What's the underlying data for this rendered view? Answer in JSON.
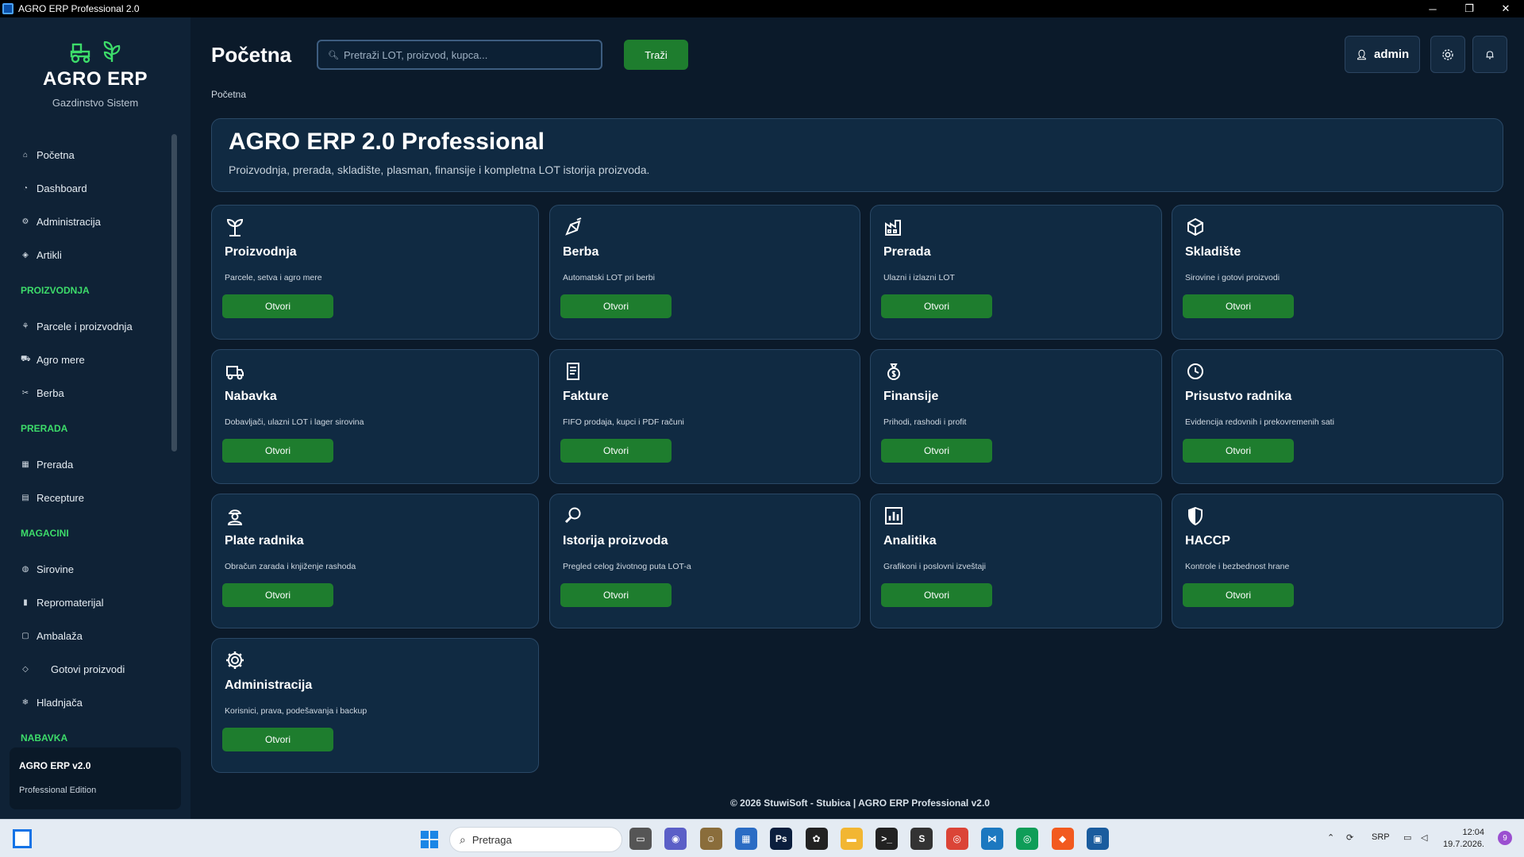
{
  "window": {
    "title": "AGRO ERP Professional 2.0",
    "minimize": "─",
    "maximize": "❐",
    "close": "✕"
  },
  "sidebar": {
    "brand": "AGRO ERP",
    "subtitle": "Gazdinstvo Sistem",
    "items": [
      {
        "type": "item",
        "label": "Početna",
        "icon": "home-icon"
      },
      {
        "type": "item",
        "label": "Dashboard",
        "icon": "dashboard-icon"
      },
      {
        "type": "item",
        "label": "Administracija",
        "icon": "gear-icon"
      },
      {
        "type": "item",
        "label": "Artikli",
        "icon": "tag-icon"
      },
      {
        "type": "section",
        "label": "PROIZVODNJA"
      },
      {
        "type": "item",
        "label": "Parcele i proizvodnja",
        "icon": "sprout-icon"
      },
      {
        "type": "item",
        "label": "Agro mere",
        "icon": "tractor-icon"
      },
      {
        "type": "item",
        "label": "Berba",
        "icon": "harvest-icon"
      },
      {
        "type": "section",
        "label": "PRERADA"
      },
      {
        "type": "item",
        "label": "Prerada",
        "icon": "factory-icon"
      },
      {
        "type": "item",
        "label": "Recepture",
        "icon": "recipe-icon"
      },
      {
        "type": "section",
        "label": "MAGACINI"
      },
      {
        "type": "item",
        "label": "Sirovine",
        "icon": "raw-materials-icon"
      },
      {
        "type": "item",
        "label": "Repromaterijal",
        "icon": "bottle-icon"
      },
      {
        "type": "item",
        "label": "Ambalaža",
        "icon": "box-icon"
      },
      {
        "type": "item",
        "label": "Gotovi proizvodi",
        "icon": "product-icon"
      },
      {
        "type": "item",
        "label": "Hladnjača",
        "icon": "snowflake-icon"
      },
      {
        "type": "section",
        "label": "NABAVKA"
      }
    ],
    "version_title": "AGRO ERP v2.0",
    "version_sub": "Professional Edition"
  },
  "header": {
    "title": "Početna",
    "search_placeholder": "Pretraži LOT, proizvod, kupca...",
    "search_button": "Traži",
    "user": "admin",
    "settings_icon": "gear-icon",
    "notifications_icon": "bell-icon"
  },
  "breadcrumb": "Početna",
  "hero": {
    "title": "AGRO ERP 2.0 Professional",
    "subtitle": "Proizvodnja, prerada, skladište, plasman, finansije i kompletna LOT istorija proizvoda."
  },
  "modules": [
    {
      "title": "Proizvodnja",
      "desc": "Parcele, setva i agro mere",
      "button": "Otvori",
      "icon": "sprout-icon"
    },
    {
      "title": "Berba",
      "desc": "Automatski LOT pri berbi",
      "button": "Otvori",
      "icon": "harvest-icon"
    },
    {
      "title": "Prerada",
      "desc": "Ulazni i izlazni LOT",
      "button": "Otvori",
      "icon": "factory-icon"
    },
    {
      "title": "Skladište",
      "desc": "Sirovine i gotovi proizvodi",
      "button": "Otvori",
      "icon": "package-icon"
    },
    {
      "title": "Nabavka",
      "desc": "Dobavljači, ulazni LOT i lager sirovina",
      "button": "Otvori",
      "icon": "truck-icon"
    },
    {
      "title": "Fakture",
      "desc": "FIFO prodaja, kupci i PDF računi",
      "button": "Otvori",
      "icon": "invoice-icon"
    },
    {
      "title": "Finansije",
      "desc": "Prihodi, rashodi i profit",
      "button": "Otvori",
      "icon": "money-bag-icon"
    },
    {
      "title": "Prisustvo radnika",
      "desc": "Evidencija redovnih i prekovremenih sati",
      "button": "Otvori",
      "icon": "clock-icon"
    },
    {
      "title": "Plate radnika",
      "desc": "Obračun zarada i knjiženje rashoda",
      "button": "Otvori",
      "icon": "worker-icon"
    },
    {
      "title": "Istorija proizvoda",
      "desc": "Pregled celog životnog puta LOT-a",
      "button": "Otvori",
      "icon": "magnifier-icon"
    },
    {
      "title": "Analitika",
      "desc": "Grafikoni i poslovni izveštaji",
      "button": "Otvori",
      "icon": "chart-icon"
    },
    {
      "title": "HACCP",
      "desc": "Kontrole i bezbednost hrane",
      "button": "Otvori",
      "icon": "shield-icon"
    },
    {
      "title": "Administracija",
      "desc": "Korisnici, prava, podešavanja i backup",
      "button": "Otvori",
      "icon": "gear-icon"
    }
  ],
  "footer": "© 2026 StuwiSoft - Stubica | AGRO ERP Professional v2.0",
  "taskbar": {
    "search": "Pretraga",
    "language": "SRP",
    "time": "12:04",
    "date": "19.7.2026.",
    "badge": "9",
    "apps": [
      "file-explorer",
      "meet",
      "avatar",
      "store",
      "photoshop",
      "chatgpt",
      "folder",
      "terminal",
      "s-app",
      "chrome",
      "vscode",
      "chrome-profile",
      "brave",
      "agro-erp"
    ]
  }
}
